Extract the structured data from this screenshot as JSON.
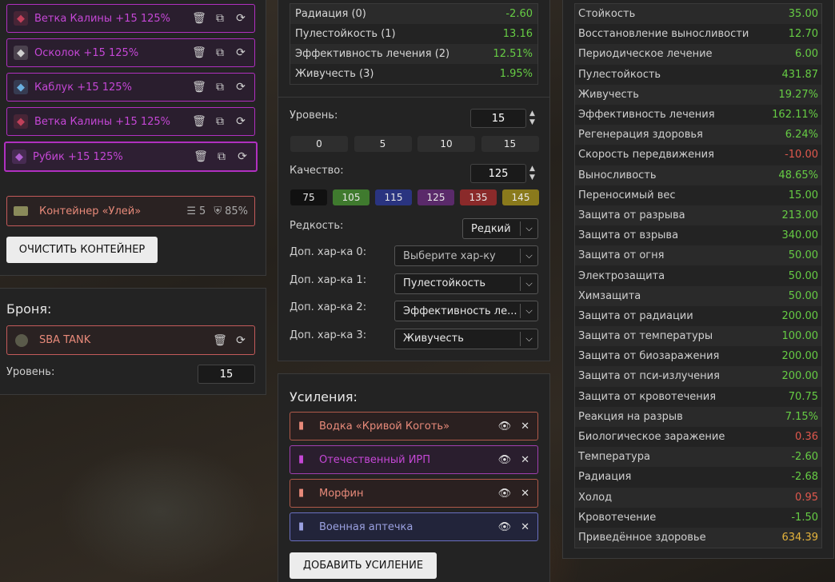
{
  "artifacts": [
    {
      "label": "Ветка Калины +15 125%",
      "icon": "flower-branch-icon",
      "color": "#c0405a"
    },
    {
      "label": "Осколок +15 125%",
      "icon": "shard-icon",
      "color": "#d0d0d0"
    },
    {
      "label": "Каблук +15 125%",
      "icon": "heel-icon",
      "color": "#6ab0e0"
    },
    {
      "label": "Ветка Калины +15 125%",
      "icon": "flower-branch-icon",
      "color": "#c0405a"
    },
    {
      "label": "Рубик +15 125%",
      "icon": "cube-icon",
      "color": "#b060d0"
    }
  ],
  "container": {
    "label": "Контейнер «Улей»",
    "slots": "5",
    "protection": "85%"
  },
  "clear_button": "ОЧИСТИТЬ КОНТЕЙНЕР",
  "armor": {
    "heading": "Броня:",
    "name": "SBA TANK",
    "level_label": "Уровень:",
    "level": "15"
  },
  "summary": [
    {
      "name": "Радиация (0)",
      "value": "-2.60",
      "cls": "num-g"
    },
    {
      "name": "Пулестойкость (1)",
      "value": "13.16",
      "cls": "num-g"
    },
    {
      "name": "Эффективность лечения (2)",
      "value": "12.51%",
      "cls": "num-g"
    },
    {
      "name": "Живучесть (3)",
      "value": "1.95%",
      "cls": "num-g"
    }
  ],
  "level_section": {
    "label": "Уровень:",
    "value": "15",
    "presets": [
      "0",
      "5",
      "10",
      "15"
    ]
  },
  "quality_section": {
    "label": "Качество:",
    "value": "125",
    "presets": [
      {
        "v": "75",
        "bg": "#111"
      },
      {
        "v": "105",
        "bg": "#3f7a2e"
      },
      {
        "v": "115",
        "bg": "#2a3480"
      },
      {
        "v": "125",
        "bg": "#5a2a6a"
      },
      {
        "v": "135",
        "bg": "#8a2a2a"
      },
      {
        "v": "145",
        "bg": "#8a7a1c"
      }
    ]
  },
  "rarity": {
    "label": "Редкость:",
    "value": "Редкий"
  },
  "extras": [
    {
      "label": "Доп. хар-ка 0:",
      "value": "Выберите хар-ку"
    },
    {
      "label": "Доп. хар-ка 1:",
      "value": "Пулестойкость"
    },
    {
      "label": "Доп. хар-ка 2:",
      "value": "Эффективность ле..."
    },
    {
      "label": "Доп. хар-ка 3:",
      "value": "Живучесть"
    }
  ],
  "boosts_heading": "Усиления:",
  "boosts": [
    {
      "label": "Водка «Кривой Коготь»",
      "color": "#e88a7a",
      "border": "#b05a4a",
      "bg": "#2a2020"
    },
    {
      "label": "Отечественный ИРП",
      "color": "#c547d6",
      "border": "#a040b0",
      "bg": "#2a1e2e"
    },
    {
      "label": "Морфин",
      "color": "#e88a7a",
      "border": "#b05a4a",
      "bg": "#2a2020"
    },
    {
      "label": "Военная аптечка",
      "color": "#9aa0e0",
      "border": "#6a70c0",
      "bg": "#22243a"
    }
  ],
  "add_boost": "ДОБАВИТЬ УСИЛЕНИЕ",
  "stats": [
    {
      "name": "Стойкость",
      "value": "35.00",
      "cls": "num-g"
    },
    {
      "name": "Восстановление выносливости",
      "value": "12.70",
      "cls": "num-g"
    },
    {
      "name": "Периодическое лечение",
      "value": "6.00",
      "cls": "num-g"
    },
    {
      "name": "Пулестойкость",
      "value": "431.87",
      "cls": "num-g"
    },
    {
      "name": "Живучесть",
      "value": "19.27%",
      "cls": "num-g"
    },
    {
      "name": "Эффективность лечения",
      "value": "162.11%",
      "cls": "num-g"
    },
    {
      "name": "Регенерация здоровья",
      "value": "6.24%",
      "cls": "num-g"
    },
    {
      "name": "Скорость передвижения",
      "value": "-10.00",
      "cls": "num-r"
    },
    {
      "name": "Выносливость",
      "value": "48.65%",
      "cls": "num-g"
    },
    {
      "name": "Переносимый вес",
      "value": "15.00",
      "cls": "num-g"
    },
    {
      "name": "Защита от разрыва",
      "value": "213.00",
      "cls": "num-g"
    },
    {
      "name": "Защита от взрыва",
      "value": "340.00",
      "cls": "num-g"
    },
    {
      "name": "Защита от огня",
      "value": "50.00",
      "cls": "num-g"
    },
    {
      "name": "Электрозащита",
      "value": "50.00",
      "cls": "num-g"
    },
    {
      "name": "Химзащита",
      "value": "50.00",
      "cls": "num-g"
    },
    {
      "name": "Защита от радиации",
      "value": "200.00",
      "cls": "num-g"
    },
    {
      "name": "Защита от температуры",
      "value": "100.00",
      "cls": "num-g"
    },
    {
      "name": "Защита от биозаражения",
      "value": "200.00",
      "cls": "num-g"
    },
    {
      "name": "Защита от пси-излучения",
      "value": "200.00",
      "cls": "num-g"
    },
    {
      "name": "Защита от кровотечения",
      "value": "70.75",
      "cls": "num-g"
    },
    {
      "name": "Реакция на разрыв",
      "value": "7.15%",
      "cls": "num-g"
    },
    {
      "name": "Биологическое заражение",
      "value": "0.36",
      "cls": "num-r"
    },
    {
      "name": "Температура",
      "value": "-2.60",
      "cls": "num-g"
    },
    {
      "name": "Радиация",
      "value": "-2.68",
      "cls": "num-g"
    },
    {
      "name": "Холод",
      "value": "0.95",
      "cls": "num-r"
    },
    {
      "name": "Кровотечение",
      "value": "-1.50",
      "cls": "num-g"
    },
    {
      "name": "Приведённое здоровье",
      "value": "634.39",
      "cls": "num-y"
    }
  ]
}
